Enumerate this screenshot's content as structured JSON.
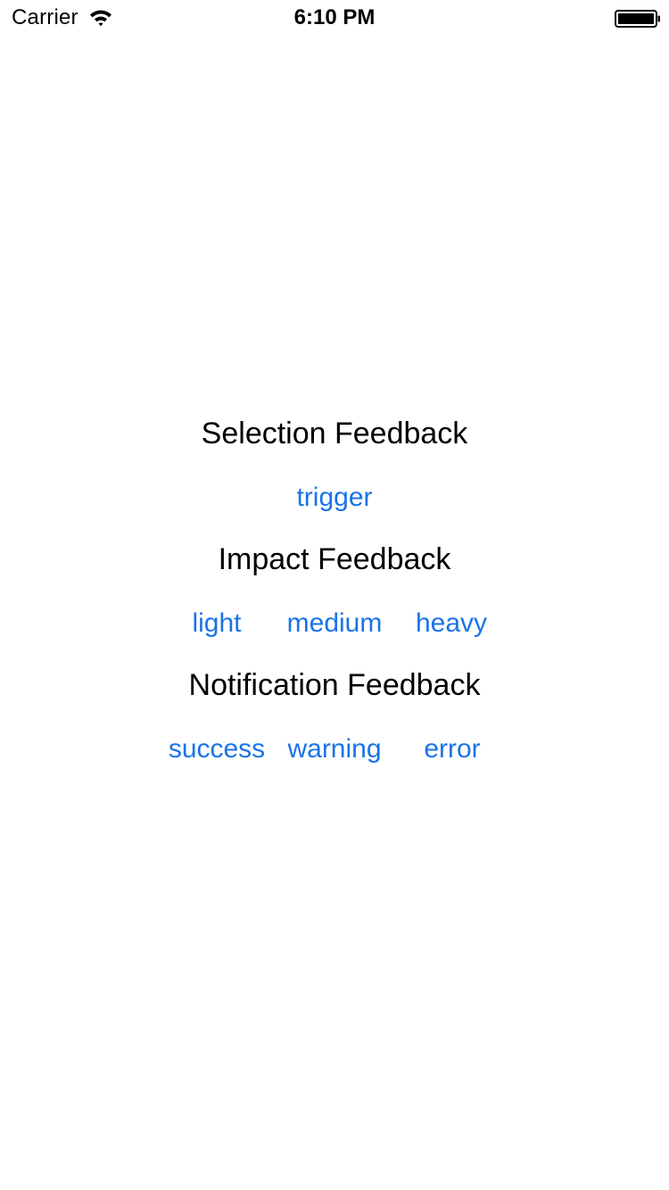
{
  "status_bar": {
    "carrier": "Carrier",
    "time": "6:10 PM",
    "wifi_icon": "wifi-icon",
    "battery_icon": "battery-full-icon"
  },
  "sections": {
    "selection": {
      "title": "Selection Feedback",
      "buttons": [
        "trigger"
      ]
    },
    "impact": {
      "title": "Impact Feedback",
      "buttons": [
        "light",
        "medium",
        "heavy"
      ]
    },
    "notification": {
      "title": "Notification Feedback",
      "buttons": [
        "success",
        "warning",
        "error"
      ]
    }
  },
  "colors": {
    "button": "#1a73e8",
    "text": "#000000",
    "background": "#ffffff"
  }
}
